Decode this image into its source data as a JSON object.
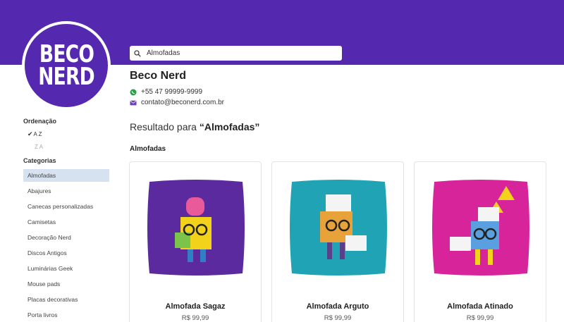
{
  "brand": {
    "logo_line1": "BECO",
    "logo_line2": "NERD",
    "name": "Beco Nerd",
    "phone": "+55 47 99999-9999",
    "email": "contato@beconerd.com.br",
    "primary_color": "#5528b0"
  },
  "search": {
    "value": "Almofadas",
    "icon": "search-icon"
  },
  "result": {
    "prefix": "Resultado para ",
    "query": "“Almofadas”"
  },
  "section_title": "Almofadas",
  "sidebar": {
    "sort_heading": "Ordenação",
    "sort_options": [
      {
        "label": "A Z",
        "selected": true
      },
      {
        "label": "Z A",
        "selected": false
      }
    ],
    "categories_heading": "Categorias",
    "categories": [
      "Almofadas",
      "Abajures",
      "Canecas personalizadas",
      "Camisetas",
      "Decoração Nerd",
      "Discos Antigos",
      "Luminárias Geek",
      "Mouse pads",
      "Placas decorativas",
      "Porta livros"
    ],
    "active_category": "Almofadas"
  },
  "products": [
    {
      "name": "Almofada Sagaz",
      "price": "R$ 99,99",
      "pillow_color": "#5b2a9e"
    },
    {
      "name": "Almofada Arguto",
      "price": "R$ 99,99",
      "pillow_color": "#1fa3b5"
    },
    {
      "name": "Almofada Atinado",
      "price": "R$ 99,99",
      "pillow_color": "#d8249a"
    }
  ]
}
